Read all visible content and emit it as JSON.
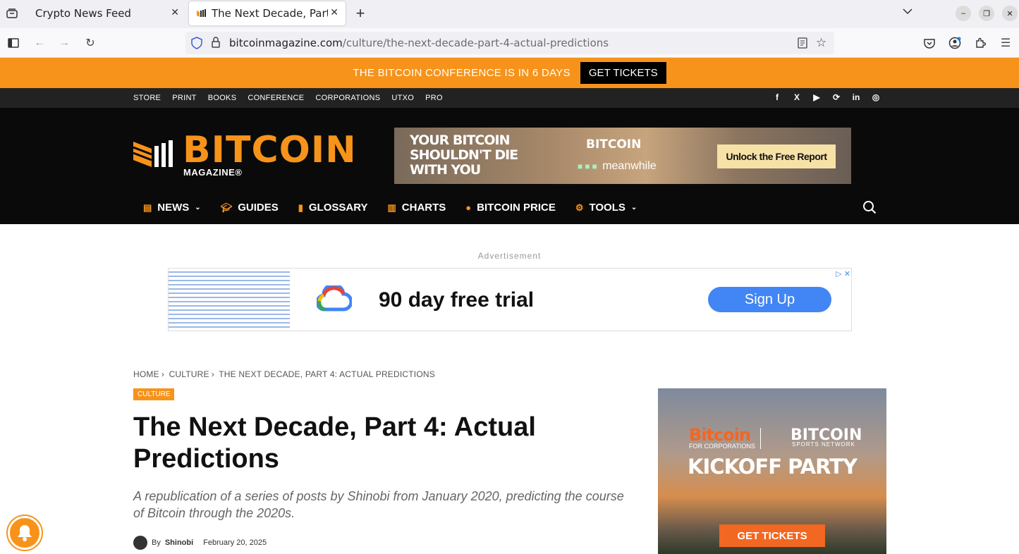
{
  "browser": {
    "tabs": [
      {
        "title": "Crypto News Feed"
      },
      {
        "title": "The Next Decade, Part 4:"
      }
    ],
    "url_domain": "bitcoinmagazine.com",
    "url_path": "/culture/the-next-decade-part-4-actual-predictions"
  },
  "promo": {
    "text": "THE BITCOIN CONFERENCE IS IN 6 DAYS",
    "button": "GET TICKETS"
  },
  "topnav": {
    "links": [
      "STORE",
      "PRINT",
      "BOOKS",
      "CONFERENCE",
      "CORPORATIONS",
      "UTXO",
      "PRO"
    ],
    "social": [
      "f",
      "X",
      "▶",
      "⟳",
      "in",
      "◎"
    ]
  },
  "logo": {
    "word": "BITCOIN",
    "sub": "MAGAZINE®"
  },
  "banner": {
    "headline": "YOUR BITCOIN SHOULDN'T DIE WITH YOU",
    "brand": "BITCOIN",
    "partner": "meanwhile",
    "cta": "Unlock the Free Report"
  },
  "mainnav": {
    "items": [
      "NEWS",
      "GUIDES",
      "GLOSSARY",
      "CHARTS",
      "BITCOIN PRICE",
      "TOOLS"
    ]
  },
  "ad": {
    "label": "Advertisement",
    "text": "90 day free trial",
    "button": "Sign Up"
  },
  "article": {
    "breadcrumb": [
      "HOME",
      "CULTURE",
      "THE NEXT DECADE, PART 4: ACTUAL PREDICTIONS"
    ],
    "category": "CULTURE",
    "title": "The Next Decade, Part 4: Actual Predictions",
    "subtitle": "A republication of a series of posts by Shinobi from January 2020, predicting the course of Bitcoin through the 2020s.",
    "by": "By",
    "author": "Shinobi",
    "date": "February 20, 2025"
  },
  "side_ad": {
    "brand1": "Bitcoin",
    "brand1_sub": "FOR CORPORATIONS",
    "brand2": "BITCOIN",
    "brand2_sub": "SPORTS NETWORK",
    "headline": "KICKOFF PARTY",
    "button": "GET TICKETS"
  },
  "colors": {
    "brand_orange": "#f7931a",
    "dark": "#0a0a0a"
  }
}
